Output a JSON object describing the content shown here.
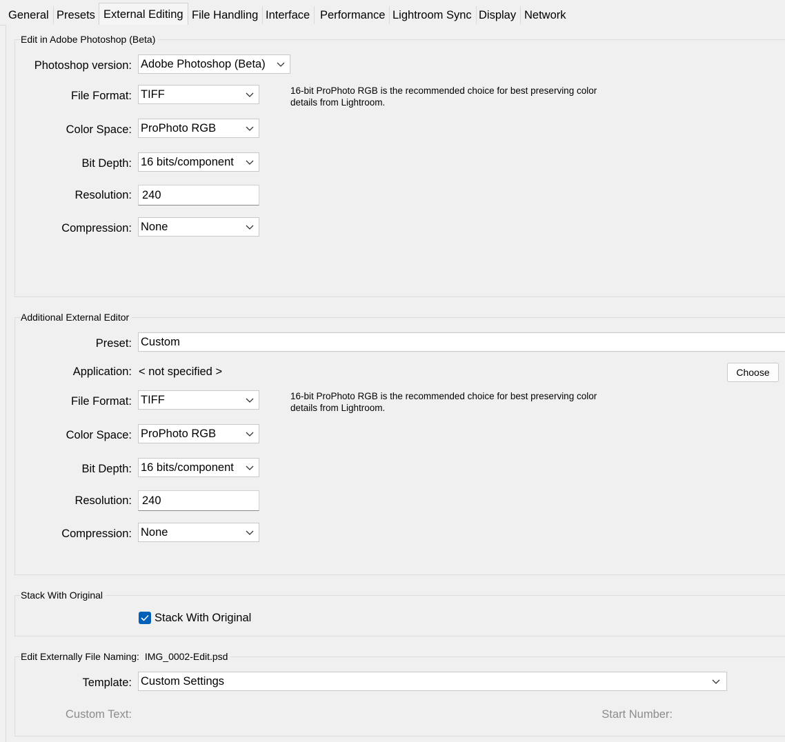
{
  "tabs": [
    {
      "label": "General"
    },
    {
      "label": "Presets"
    },
    {
      "label": "External Editing"
    },
    {
      "label": "File Handling"
    },
    {
      "label": "Interface"
    },
    {
      "label": "Performance"
    },
    {
      "label": "Lightroom Sync"
    },
    {
      "label": "Display"
    },
    {
      "label": "Network"
    }
  ],
  "active_tab": "External Editing",
  "photoshop": {
    "legend": "Edit in Adobe Photoshop (Beta)",
    "version_label": "Photoshop version:",
    "version_value": "Adobe Photoshop (Beta)",
    "file_format_label": "File Format:",
    "file_format_value": "TIFF",
    "note": "16-bit ProPhoto RGB is the recommended choice for best preserving color details from Lightroom.",
    "color_space_label": "Color Space:",
    "color_space_value": "ProPhoto RGB",
    "bit_depth_label": "Bit Depth:",
    "bit_depth_value": "16 bits/component",
    "resolution_label": "Resolution:",
    "resolution_value": "240",
    "compression_label": "Compression:",
    "compression_value": "None"
  },
  "additional": {
    "legend": "Additional External Editor",
    "preset_label": "Preset:",
    "preset_value": "Custom",
    "application_label": "Application:",
    "application_value": "< not specified >",
    "choose_label": "Choose",
    "file_format_label": "File Format:",
    "file_format_value": "TIFF",
    "note": "16-bit ProPhoto RGB is the recommended choice for best preserving color details from Lightroom.",
    "color_space_label": "Color Space:",
    "color_space_value": "ProPhoto RGB",
    "bit_depth_label": "Bit Depth:",
    "bit_depth_value": "16 bits/component",
    "resolution_label": "Resolution:",
    "resolution_value": "240",
    "compression_label": "Compression:",
    "compression_value": "None"
  },
  "stack": {
    "legend": "Stack With Original",
    "checkbox_label": "Stack With Original",
    "checked": true
  },
  "naming": {
    "legend": "Edit Externally File Naming:",
    "filename": "IMG_0002-Edit.psd",
    "template_label": "Template:",
    "template_value": "Custom Settings",
    "custom_text_label": "Custom Text:",
    "start_number_label": "Start Number:"
  },
  "colors": {
    "checkbox": "#005fb8",
    "background": "#f0f0f0",
    "disabled_text": "#8c8c8c"
  }
}
